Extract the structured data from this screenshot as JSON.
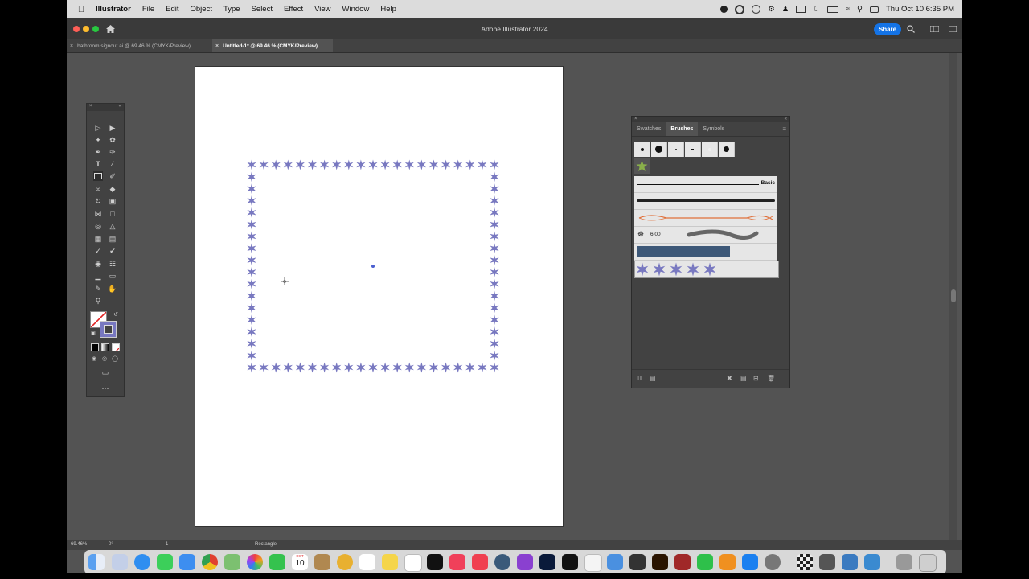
{
  "menubar": {
    "app_name": "Illustrator",
    "items": [
      "File",
      "Edit",
      "Object",
      "Type",
      "Select",
      "Effect",
      "View",
      "Window",
      "Help"
    ],
    "clock": "Thu Oct 10  6:35 PM"
  },
  "window": {
    "title": "Adobe Illustrator 2024",
    "share_label": "Share"
  },
  "tabs": [
    {
      "label": "bathroom signout.ai @ 69.46 % (CMYK/Preview)",
      "active": false
    },
    {
      "label": "Untitled-1* @ 69.46 % (CMYK/Preview)",
      "active": true
    }
  ],
  "brushes_panel": {
    "tabs": [
      "Swatches",
      "Brushes",
      "Symbols"
    ],
    "active_tab": "Brushes",
    "basic_label": "Basic",
    "size_label": "6.00"
  },
  "status": {
    "zoom": "69.46%",
    "rotation": "0°",
    "artboard_num": "1",
    "tool_name": "Rectangle"
  },
  "dock": {
    "calendar_month": "OCT",
    "calendar_day": "10"
  },
  "colors": {
    "star": "#7878c0",
    "ui_dark": "#535353",
    "panel": "#424242",
    "accent": "#1473e6"
  }
}
